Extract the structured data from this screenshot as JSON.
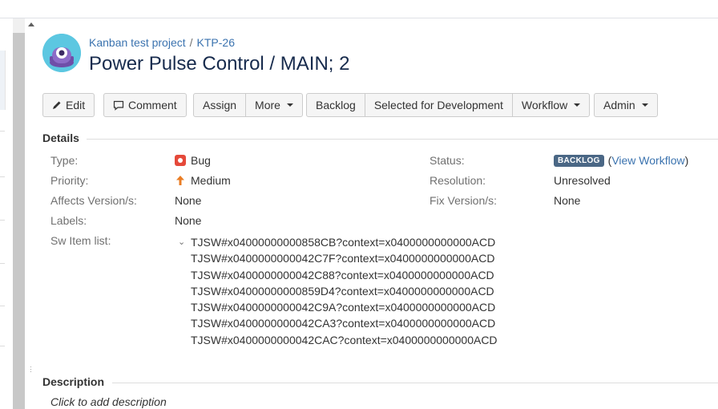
{
  "breadcrumb": {
    "project": "Kanban test project",
    "separator": "/",
    "issue_key": "KTP-26"
  },
  "issue": {
    "title": "Power Pulse Control / MAIN; 2"
  },
  "toolbar": {
    "edit": "Edit",
    "comment": "Comment",
    "assign": "Assign",
    "more": "More",
    "backlog": "Backlog",
    "selected_for_development": "Selected for Development",
    "workflow": "Workflow",
    "admin": "Admin"
  },
  "details": {
    "heading": "Details",
    "type_label": "Type:",
    "type_value": "Bug",
    "priority_label": "Priority:",
    "priority_value": "Medium",
    "affects_label": "Affects Version/s:",
    "affects_value": "None",
    "labels_label": "Labels:",
    "labels_value": "None",
    "sw_label": "Sw Item list:",
    "status_label": "Status:",
    "status_value": "BACKLOG",
    "view_workflow_open": "(",
    "view_workflow": "View Workflow",
    "view_workflow_close": ")",
    "resolution_label": "Resolution:",
    "resolution_value": "Unresolved",
    "fix_label": "Fix Version/s:",
    "fix_value": "None"
  },
  "sw_items": [
    "TJSW#x04000000000858CB?context=x0400000000000ACD",
    "TJSW#x0400000000042C7F?context=x0400000000000ACD",
    "TJSW#x0400000000042C88?context=x0400000000000ACD",
    "TJSW#x04000000000859D4?context=x0400000000000ACD",
    "TJSW#x0400000000042C9A?context=x0400000000000ACD",
    "TJSW#x0400000000042CA3?context=x0400000000000ACD",
    "TJSW#x0400000000042CAC?context=x0400000000000ACD"
  ],
  "description": {
    "heading": "Description",
    "placeholder": "Click to add description"
  },
  "colors": {
    "link": "#3b73af",
    "bug": "#e5493a",
    "priority_medium": "#ea7d24",
    "status_lozenge": "#4a6785"
  }
}
